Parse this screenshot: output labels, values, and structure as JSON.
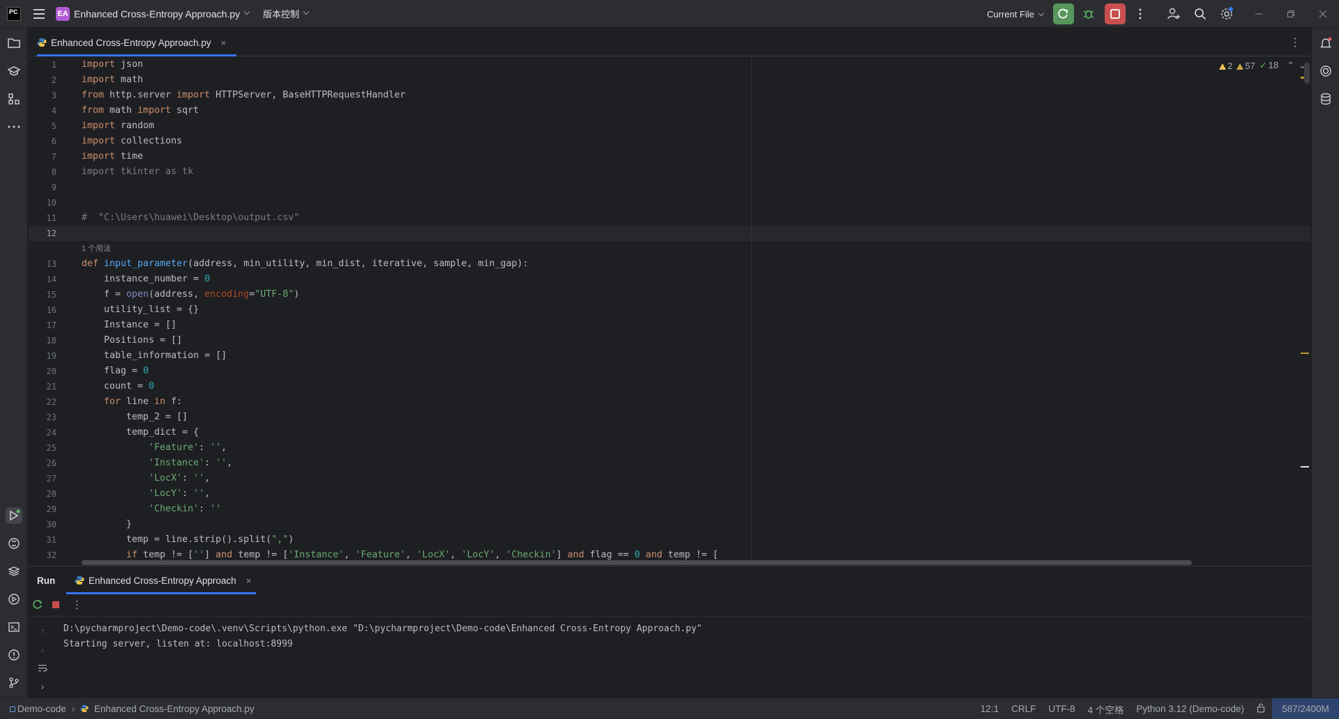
{
  "titlebar": {
    "logo_text": "PC",
    "project_badge": "EA",
    "project_name": "Enhanced Cross-Entropy Approach.py",
    "vcs_label": "版本控制",
    "run_config": "Current File",
    "icons": [
      "hamburger-menu-icon",
      "rerun-icon",
      "debug-bug-icon",
      "stop-icon",
      "more-icon",
      "add-user-icon",
      "search-icon",
      "settings-gear-icon",
      "minimize-icon",
      "restore-icon",
      "close-icon"
    ]
  },
  "left_strip": {
    "top_icons": [
      "folder-icon",
      "learn-cap-icon",
      "structure-icon",
      "more-dots-icon"
    ],
    "bottom_icons": [
      "run-icon",
      "python-console-icon",
      "layers-icon",
      "services-icon",
      "terminal-icon",
      "problems-icon",
      "git-icon"
    ]
  },
  "right_strip": {
    "icons": [
      "notifications-bell-icon",
      "ai-assistant-icon",
      "database-icon"
    ]
  },
  "editor_tab": {
    "label": "Enhanced Cross-Entropy Approach.py",
    "close": "×"
  },
  "inspections": {
    "warnings": "2",
    "weak_warnings": "57",
    "ok": "18"
  },
  "editor": {
    "current_line": "12",
    "usage_hint": "1 个用法",
    "line_numbers": [
      "1",
      "2",
      "3",
      "4",
      "5",
      "6",
      "7",
      "8",
      "9",
      "10",
      "11",
      "12",
      "13",
      "14",
      "15",
      "16",
      "17",
      "18",
      "19",
      "20",
      "21",
      "22",
      "23",
      "24",
      "25",
      "26",
      "27",
      "28",
      "29",
      "30",
      "31",
      "32"
    ]
  },
  "run_panel": {
    "title": "Run",
    "tab_label": "Enhanced Cross-Entropy Approach",
    "tab_close": "×",
    "console": [
      "D:\\pycharmproject\\Demo-code\\.venv\\Scripts\\python.exe \"D:\\pycharmproject\\Demo-code\\Enhanced Cross-Entropy Approach.py\"",
      "Starting server, listen at: localhost:8999"
    ]
  },
  "statusbar": {
    "project": "Demo-code",
    "file": "Enhanced Cross-Entropy Approach.py",
    "position": "12:1",
    "line_sep": "CRLF",
    "encoding": "UTF-8",
    "indent": "4 个空格",
    "interpreter": "Python 3.12 (Demo-code)",
    "memory": "587/2400M"
  },
  "colors": {
    "accent": "#3574f0",
    "run_green": "#57965c",
    "stop_red": "#c94f4f",
    "project_badge": "#b15bd5"
  }
}
